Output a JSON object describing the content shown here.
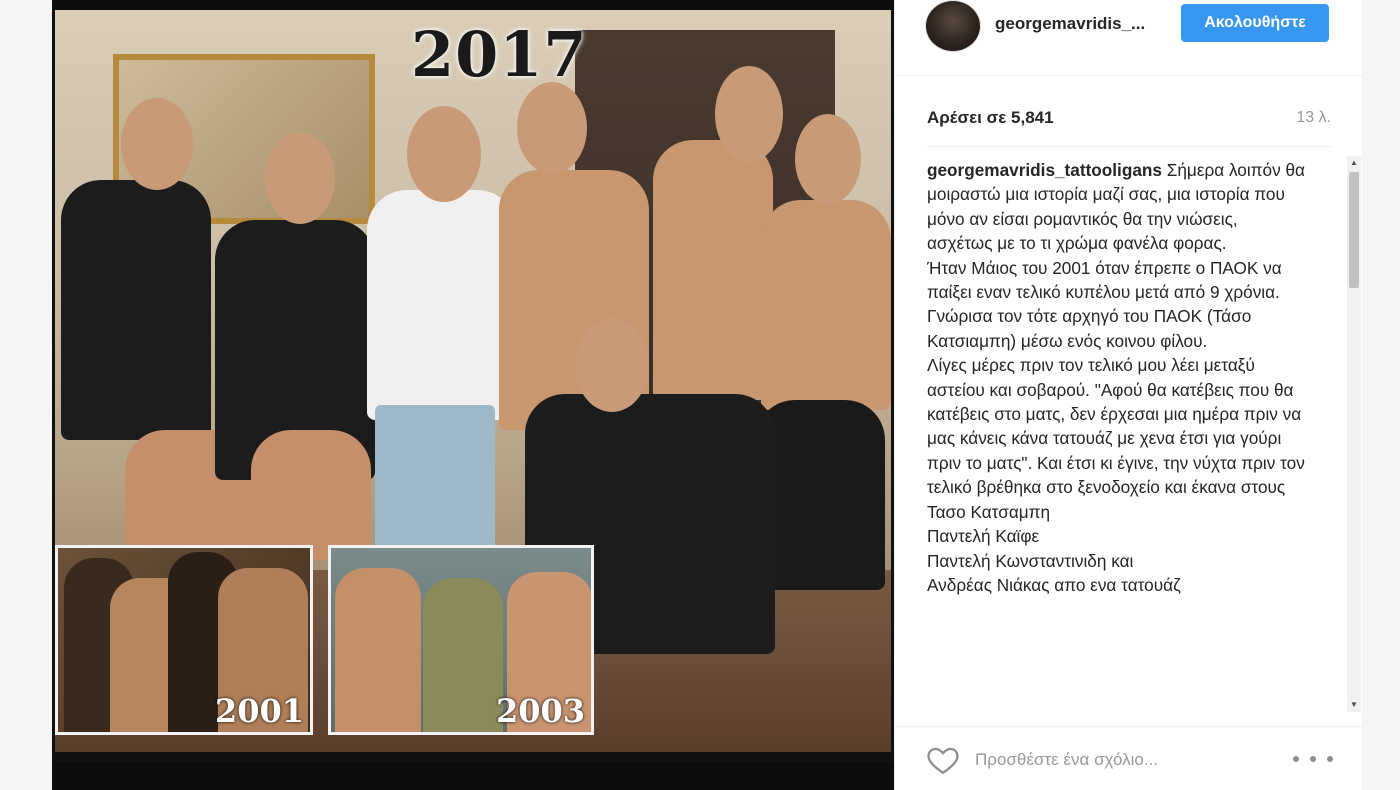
{
  "post": {
    "photo": {
      "main_year": "2017",
      "inset_left_year": "2001",
      "inset_right_year": "2003"
    },
    "header": {
      "username": "georgemavridis_...",
      "follow_label": "Ακολουθήστε"
    },
    "meta": {
      "likes": "Αρέσει σε 5,841",
      "time_ago": "13 λ."
    },
    "caption": {
      "user": "georgemavridis_tattooligans",
      "text": " Σήμερα λοιπόν θα μοιραστώ μια ιστορία μαζί σας, μια ιστορία που μόνο αν είσαι ρομαντικός θα την νιώσεις, ασχέτως με το τι χρώμα φανέλα φορας.\nΉταν Μάιος του 2001 όταν έπρεπε ο ΠΑΟΚ να παίξει εναν τελικό κυπέλου μετά από 9 χρόνια.\nΓνώρισα τον τότε αρχηγό του ΠΑΟΚ (Τάσο Κατσιαμπη) μέσω ενός κοινου φίλου.\nΛίγες μέρες πριν τον τελικό μου λέει μεταξύ αστείου και σοβαρού. \"Αφού θα κατέβεις που θα κατέβεις στο ματς, δεν έρχεσαι μια ημέρα πριν να μας κάνεις κάνα τατουάζ με χενα έτσι για γούρι πριν το ματς\". Και έτσι κι έγινε, την νύχτα πριν τον τελικό βρέθηκα στο ξενοδοχείο και έκανα στους\nΤασο Κατσαμπη\nΠαντελή Καϊφε\nΠαντελή Κωνσταντινιδη και\nΑνδρέας Νιάκας απο ενα τατουάζ"
    },
    "comment": {
      "placeholder": "Προσθέστε ένα σχόλιο..."
    },
    "icons": {
      "like": "heart-icon",
      "more": "more-options-icon",
      "scroll_up": "scroll-up-arrow-icon",
      "scroll_down": "scroll-down-arrow-icon"
    },
    "colors": {
      "follow_button": "#3897f0",
      "text": "#262626",
      "muted": "#999999"
    }
  }
}
